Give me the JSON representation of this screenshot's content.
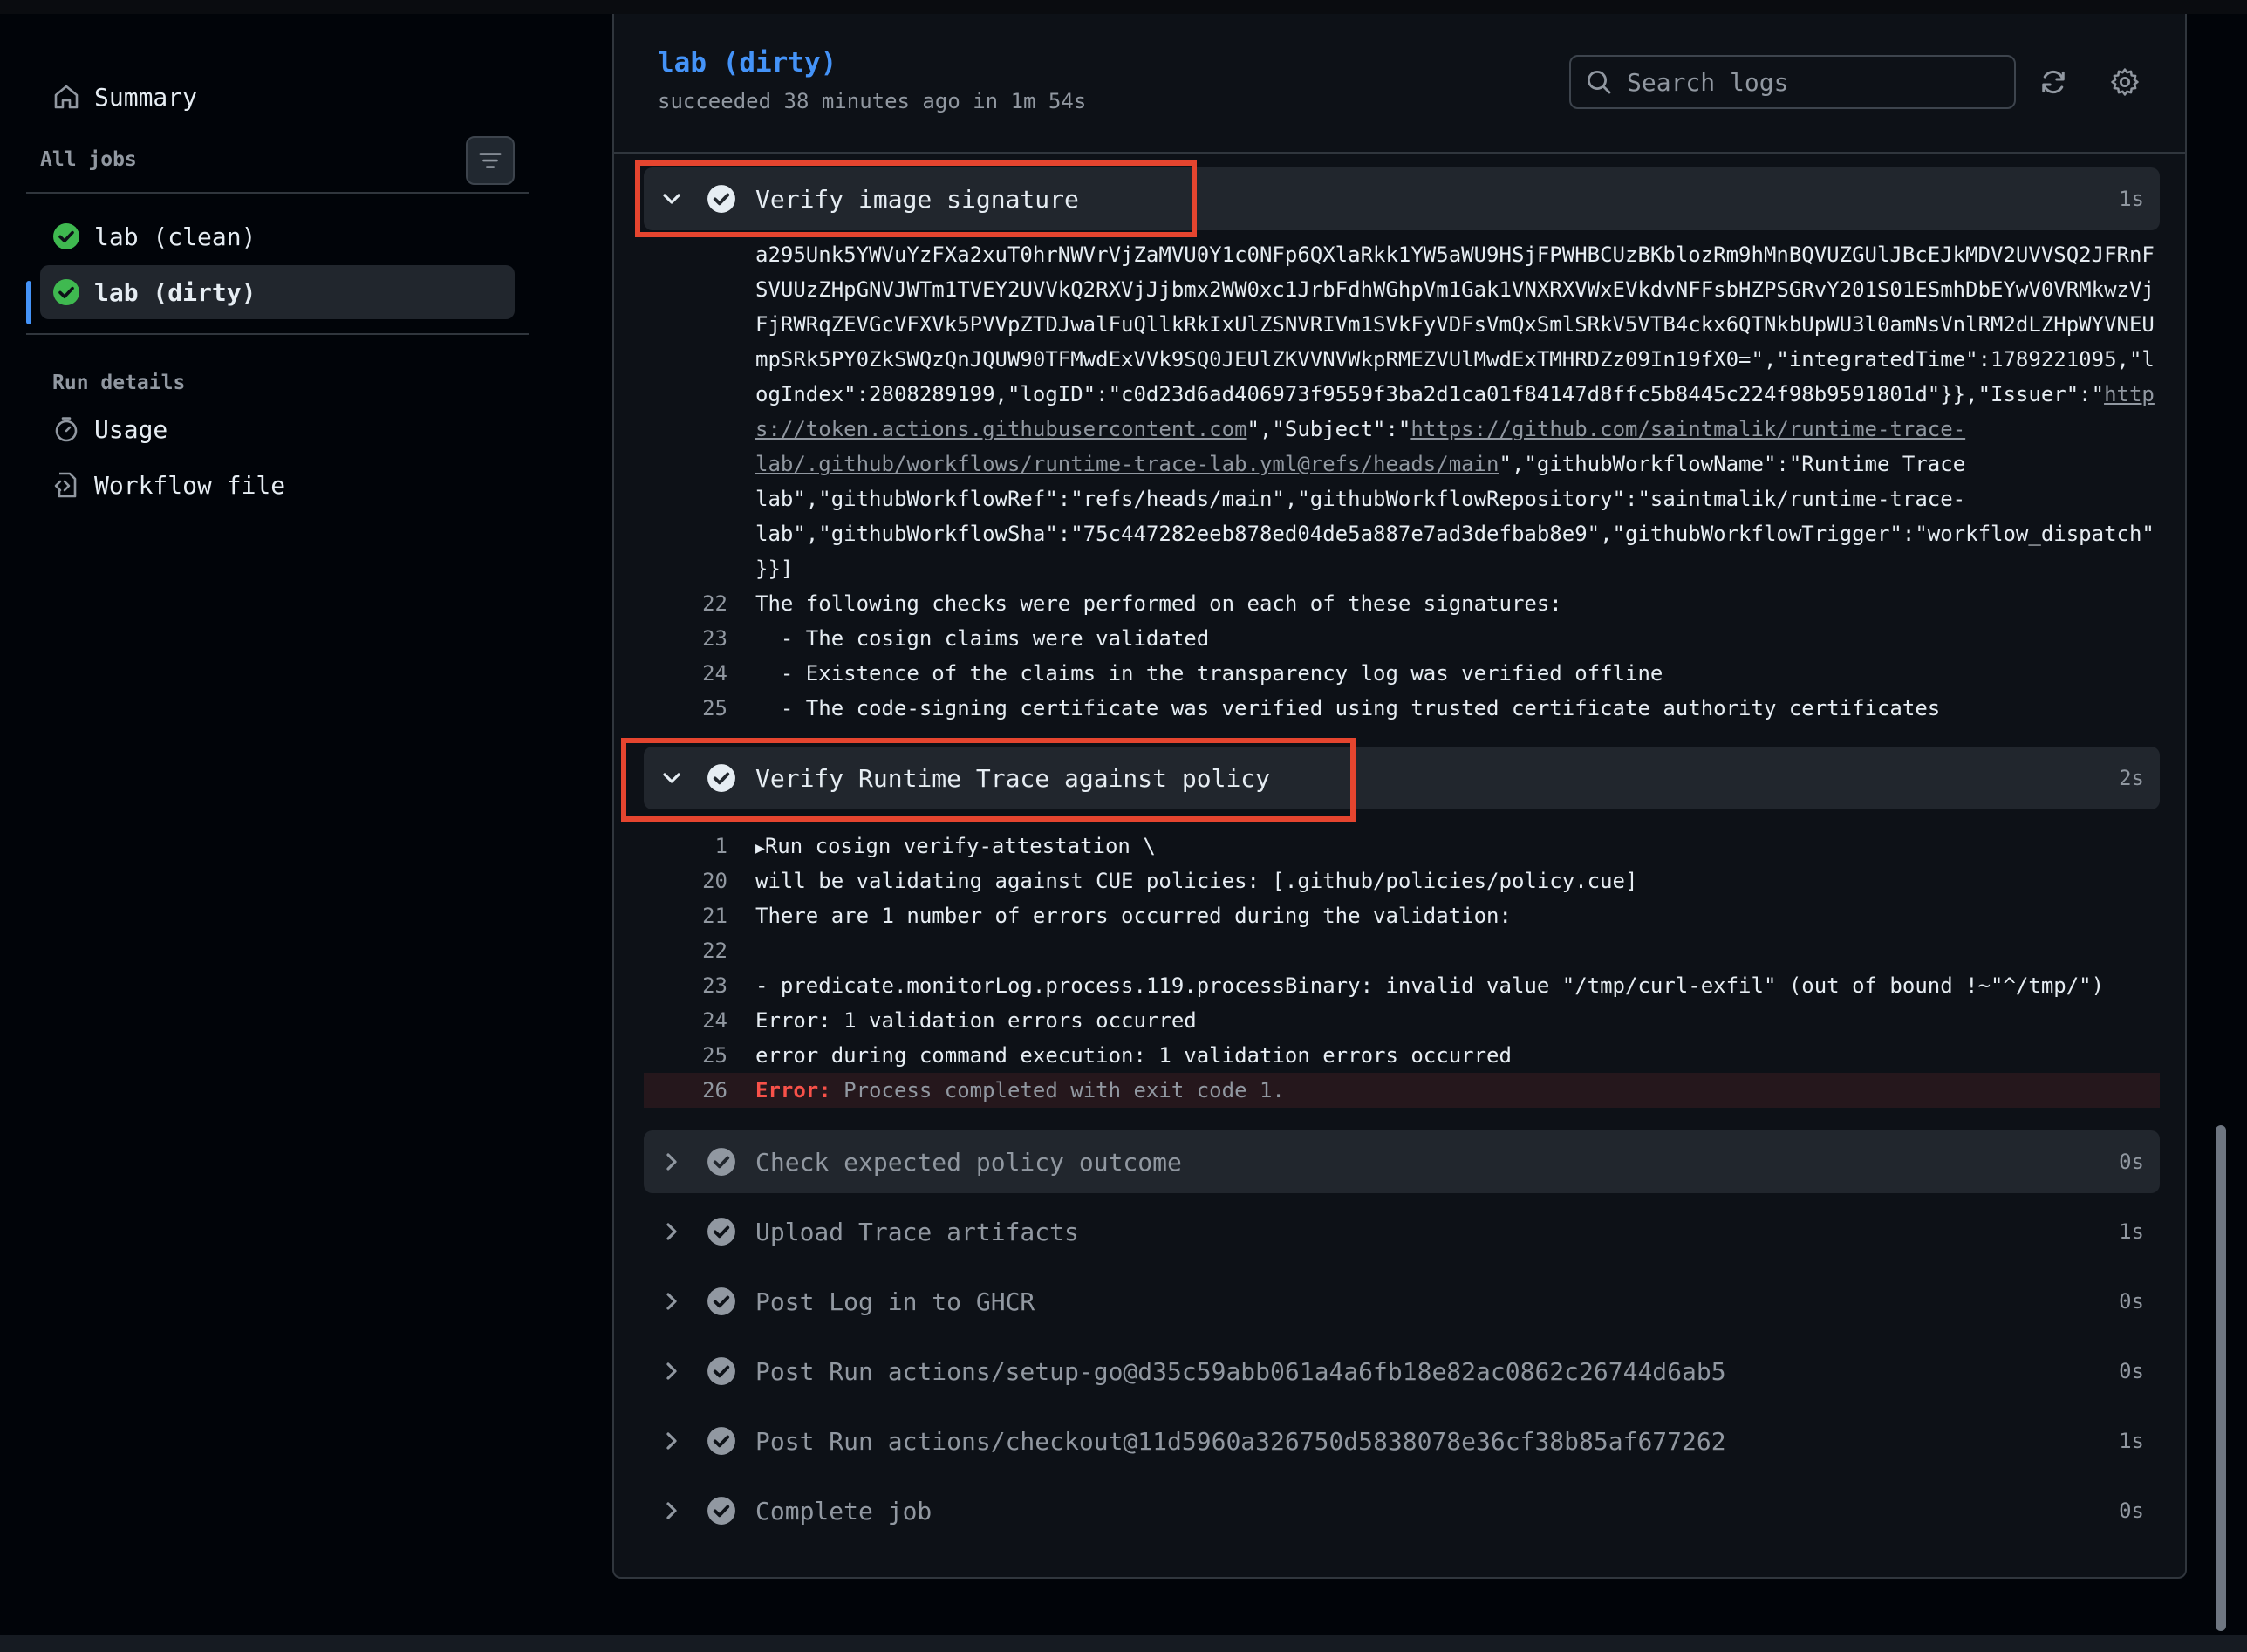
{
  "sidebar": {
    "summary_label": "Summary",
    "all_jobs_label": "All jobs",
    "jobs": [
      {
        "label": "lab (clean)",
        "status": "success"
      },
      {
        "label": "lab (dirty)",
        "status": "success",
        "active": true
      }
    ],
    "run_details_label": "Run details",
    "usage_label": "Usage",
    "workflow_file_label": "Workflow file"
  },
  "header": {
    "title": "lab (dirty)",
    "subtitle": "succeeded 38 minutes ago in 1m 54s",
    "search_placeholder": "Search logs"
  },
  "steps": [
    {
      "label": "Verify image signature",
      "duration": "1s",
      "expanded": true,
      "highlighted": true
    },
    {
      "label": "Verify Runtime Trace against policy",
      "duration": "2s",
      "expanded": true,
      "highlighted": true
    },
    {
      "label": "Check expected policy outcome",
      "duration": "0s",
      "expanded": false
    },
    {
      "label": "Upload Trace artifacts",
      "duration": "1s",
      "expanded": false
    },
    {
      "label": "Post Log in to GHCR",
      "duration": "0s",
      "expanded": false
    },
    {
      "label": "Post Run actions/setup-go@d35c59abb061a4a6fb18e82ac0862c26744d6ab5",
      "duration": "0s",
      "expanded": false
    },
    {
      "label": "Post Run actions/checkout@11d5960a326750d5838078e36cf38b85af677262",
      "duration": "1s",
      "expanded": false
    },
    {
      "label": "Complete job",
      "duration": "0s",
      "expanded": false
    }
  ],
  "step1_log": {
    "continuation": [
      "a295Unk5YWVuYzFXa2xuT0hrNWVrVjZaMVU0Y1c0NFp6QXlaRkk1YW5aWU9HSjFPWHBCUzBKblozRm9hMnBQVUZGUlJBcEJkMDV2UVVSQ2JFRnF",
      "SVUUzZHpGNVJWTm1TVEY2UVVkQ2RXVjJjbmx2WW0xc1JrbFdhWGhpVm1Gak1VNXRXVWxEVkdvNFFsbHZPSGRvY201S01ESmhDbEYwV0VRMkwzVj",
      "FjRWRqZEVGcVFXVk5PVVpZTDJwalFuQllkRkIxUlZSNVRIVm1SVkFyVDFsVmQxSmlSRkV5VTB4ckx6QTNkbUpWU3l0amNsVnlRM2dLZHpWYVNEU",
      "mpSRk5PY0ZkSWQzQnJQUW90TFMwdExVVk9SQ0JEUlZKVVNVWkpRMEZVUlMwdExTMHRDZz09In19fX0=\",\"integratedTime\":1789221095,\"l",
      "ogIndex\":2808289199,\"logID\":\"c0d23d6ad406973f9559f3ba2d1ca01f84147d8ffc5b8445c224f98b9591801d\"}},\"Issuer\":\"",
      "s://token.actions.githubusercontent.com",
      "lab/.github/workflows/runtime-trace-lab.yml@refs/heads/main",
      "lab\",\"githubWorkflowRef\":\"refs/heads/main\",\"githubWorkflowRepository\":\"saintmalik/runtime-trace-",
      "lab\",\"githubWorkflowSha\":\"75c447282eeb878ed04de5a887e7ad3defbab8e9\",\"githubWorkflowTrigger\":\"workflow_dispatch\"",
      "}}]"
    ],
    "link_http": "http",
    "subject_prefix": "\",\"Subject\":\"",
    "subject_link": "https://github.com/saintmalik/runtime-trace-",
    "after_link": "\",\"githubWorkflowName\":\"Runtime Trace",
    "lines": [
      {
        "num": "22",
        "text": "The following checks were performed on each of these signatures:"
      },
      {
        "num": "23",
        "text": "  - The cosign claims were validated"
      },
      {
        "num": "24",
        "text": "  - Existence of the claims in the transparency log was verified offline"
      },
      {
        "num": "25",
        "text": "  - The code-signing certificate was verified using trusted certificate authority certificates"
      }
    ]
  },
  "step2_log": {
    "lines": [
      {
        "num": "1",
        "text": "Run cosign verify-attestation \\"
      },
      {
        "num": "20",
        "text": "will be validating against CUE policies: [.github/policies/policy.cue]"
      },
      {
        "num": "21",
        "text": "There are 1 number of errors occurred during the validation:"
      },
      {
        "num": "22",
        "text": ""
      },
      {
        "num": "23",
        "text": "- predicate.monitorLog.process.119.processBinary: invalid value \"/tmp/curl-exfil\" (out of bound !~\"^/tmp/\")"
      },
      {
        "num": "24",
        "text": "Error: 1 validation errors occurred"
      },
      {
        "num": "25",
        "text": "error during command execution: 1 validation errors occurred"
      }
    ],
    "error_line": {
      "num": "26",
      "label": "Error:",
      "text": " Process completed with exit code 1."
    }
  },
  "colors": {
    "success": "#3fb950",
    "accent": "#4493f8",
    "error": "#f85149",
    "highlight": "#e5452f"
  }
}
